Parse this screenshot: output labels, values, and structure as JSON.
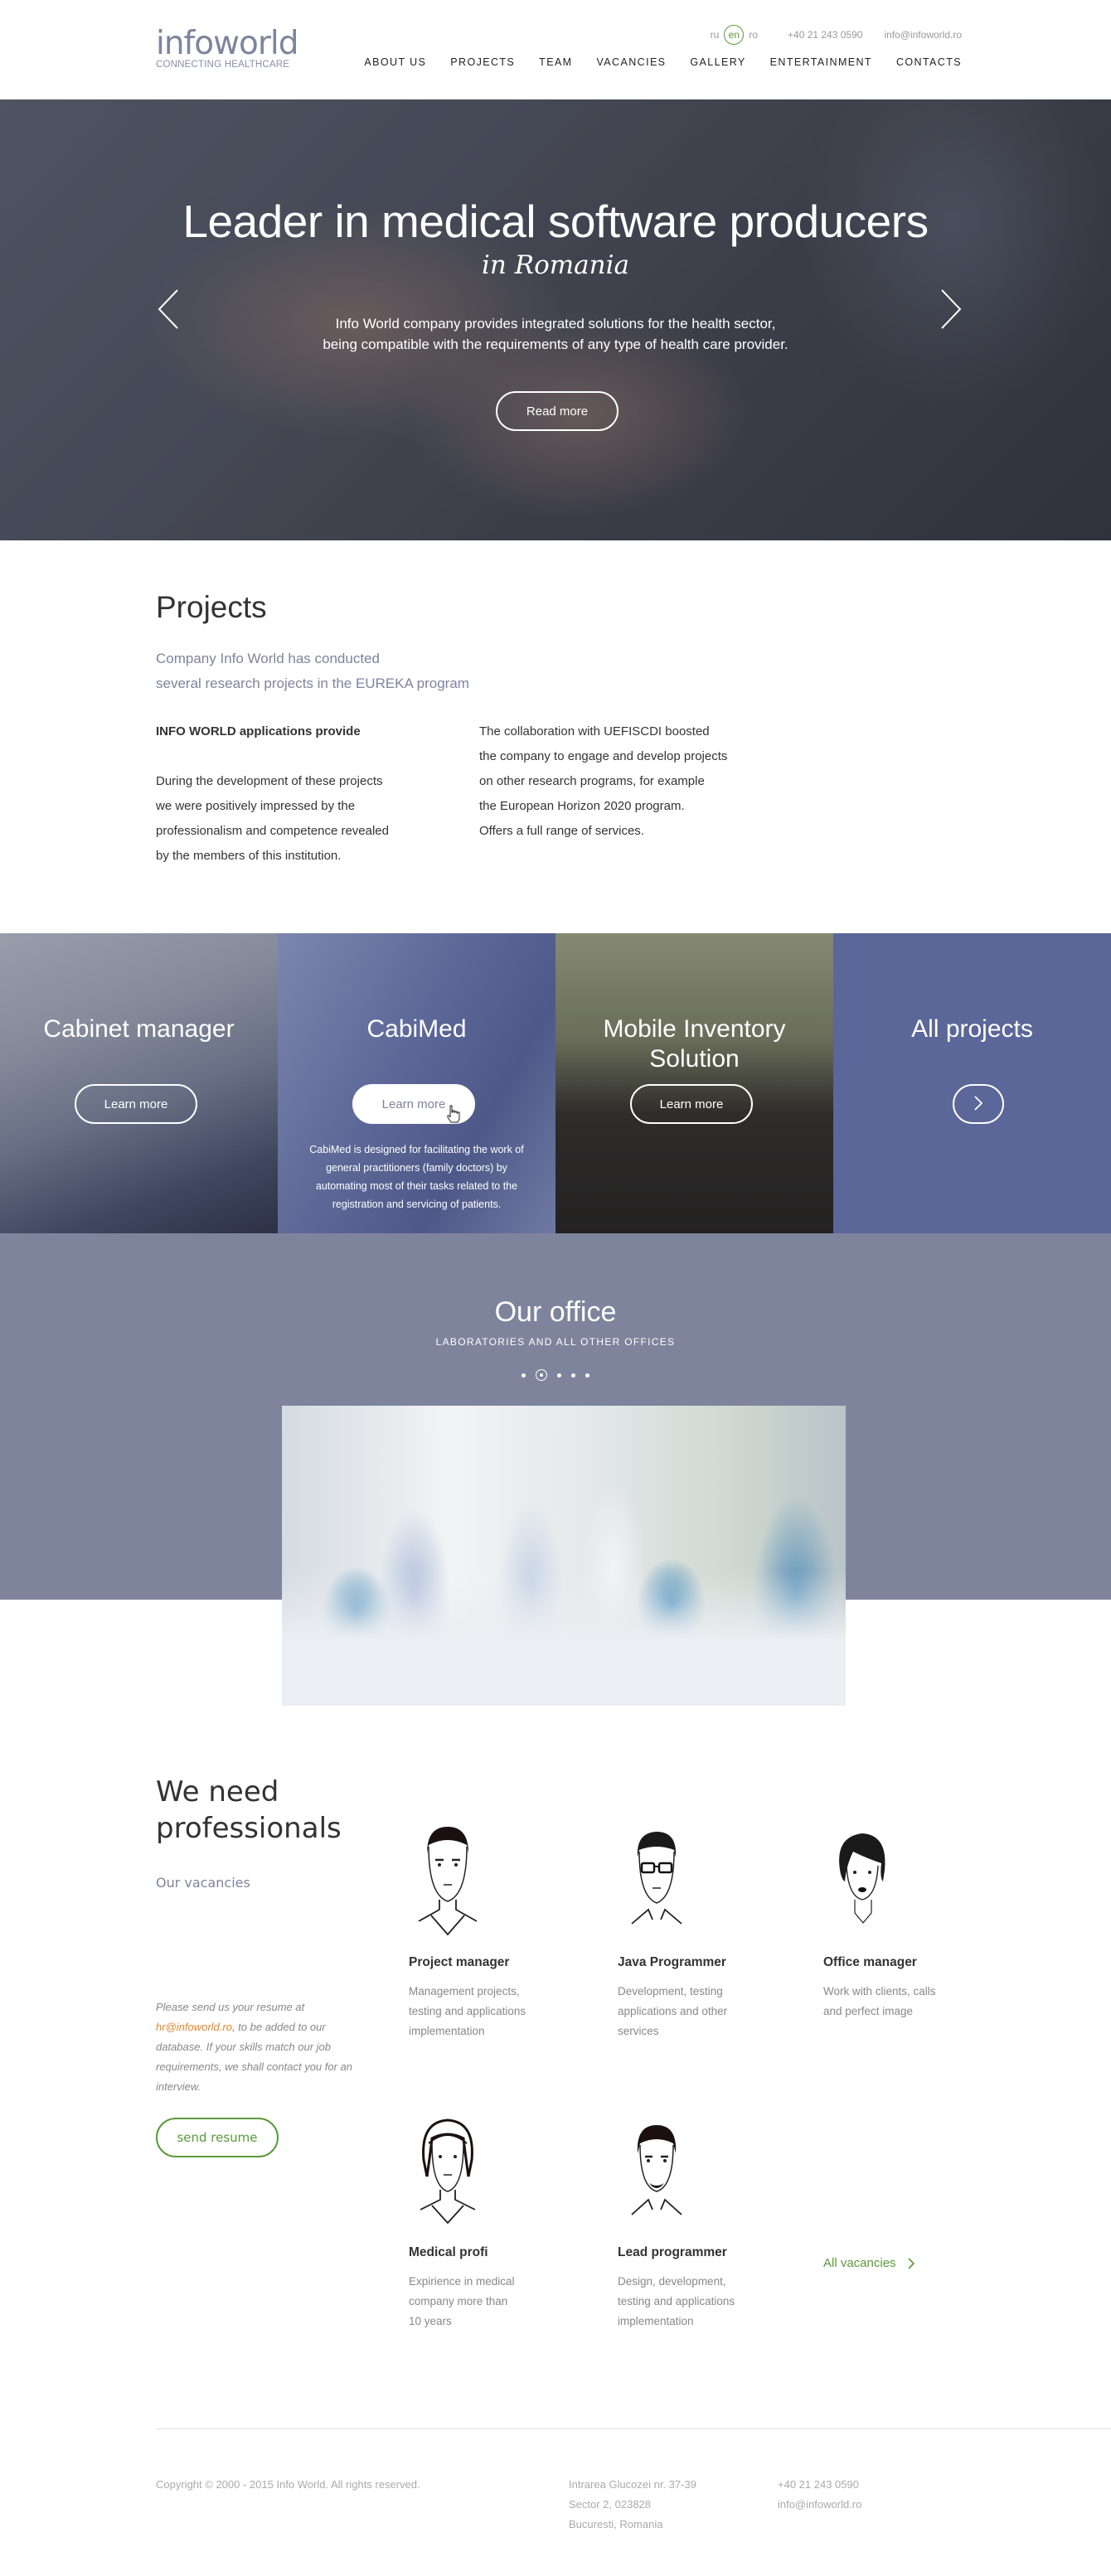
{
  "header": {
    "logo_word": "infoworld",
    "logo_tagline": "CONNECTING HEALTHCARE",
    "languages": [
      {
        "code": "ru",
        "active": false
      },
      {
        "code": "en",
        "active": true
      },
      {
        "code": "ro",
        "active": false
      }
    ],
    "phone": "+40 21 243 0590",
    "email": "info@infoworld.ro",
    "nav": [
      "ABOUT US",
      "PROJECTS",
      "TEAM",
      "VACANCIES",
      "GALLERY",
      "ENTERTAINMENT",
      "CONTACTS"
    ]
  },
  "hero": {
    "title": "Leader in medical software producers",
    "subtitle": "in Romania",
    "text_line1": "Info World company provides integrated solutions for the health sector,",
    "text_line2": "being compatible with the requirements of any type of health care provider.",
    "button": "Read more",
    "prev_icon": "chevron-left-icon",
    "next_icon": "chevron-right-icon"
  },
  "projects": {
    "heading": "Projects",
    "lead_line1": "Company Info World has conducted",
    "lead_line2": "several research projects in the EUREKA program",
    "col1_title": "INFO WORLD applications provide",
    "col1_lines": [
      "During the development of these projects",
      "we were positively impressed by the",
      "professionalism and competence revealed",
      "by the members of this institution."
    ],
    "col2_lines": [
      "The collaboration with UEFISCDI boosted",
      "the company to engage and develop projects",
      "on other research programs, for example",
      "the European Horizon 2020 program.",
      "Offers a full range of services."
    ]
  },
  "tiles": [
    {
      "title": "Cabinet manager",
      "button": "Learn more"
    },
    {
      "title": "CabiMed",
      "button": "Learn more",
      "description": "CabiMed is designed for facilitating the work of general practitioners (family doctors) by automating most of their tasks related to the registration and servicing of patients."
    },
    {
      "title": "Mobile Inventory Solution",
      "button": "Learn more"
    },
    {
      "title": "All projects",
      "icon": "chevron-right-icon"
    }
  ],
  "office": {
    "heading": "Our office",
    "subheading": "LABORATORIES AND ALL OTHER OFFICES",
    "slides_count": 5,
    "active_slide": 2
  },
  "vacancies": {
    "heading_line1": "We need",
    "heading_line2": "professionals",
    "subheading": "Our vacancies",
    "note_prefix": "Please send us your resume at",
    "note_email": "hr@infoworld.ro",
    "note_suffix": ", to be added to our database. If your skills match our job requirements, we shall contact you for an interview.",
    "send_button": "send resume",
    "jobs": [
      {
        "title": "Project manager",
        "lines": [
          "Management projects,",
          "testing and applications",
          "implementation"
        ]
      },
      {
        "title": "Java Programmer",
        "lines": [
          "Development, testing",
          "applications and other",
          "services"
        ]
      },
      {
        "title": "Office manager",
        "lines": [
          "Work with clients, calls",
          "and perfect image"
        ]
      },
      {
        "title": "Medical profi",
        "lines": [
          "Expirience in medical",
          "company more than",
          "10 years"
        ]
      },
      {
        "title": "Lead programmer",
        "lines": [
          "Design, development,",
          "testing and applications",
          "implementation"
        ]
      }
    ],
    "all_link": "All vacancies"
  },
  "footer": {
    "copyright": "Copyright © 2000 - 2015 Info World. All rights reserved.",
    "address": [
      "Intrarea Glucozei nr. 37-39",
      "Sector 2, 023828",
      "Bucuresti, Romania"
    ],
    "phone": "+40 21 243 0590",
    "email": "info@infoworld.ro"
  },
  "colors": {
    "brand": "#7e849c",
    "accent_green": "#5a9a3a",
    "link_orange": "#e0862c",
    "tile_blue": "#5b6699"
  }
}
